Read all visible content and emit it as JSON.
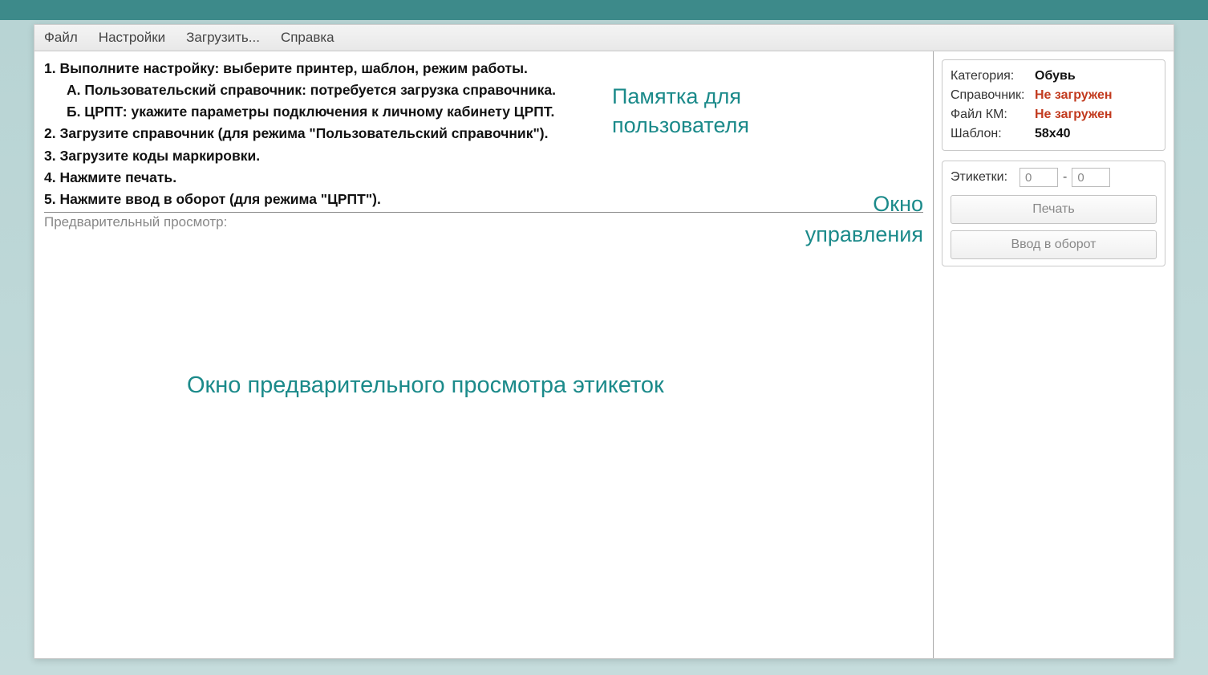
{
  "menubar": {
    "file": "Файл",
    "settings": "Настройки",
    "load": "Загрузить...",
    "help": "Справка"
  },
  "instructions": {
    "line1": "1. Выполните настройку: выберите принтер, шаблон, режим работы.",
    "line1a": "А. Пользовательский справочник: потребуется загрузка справочника.",
    "line1b": "Б. ЦРПТ: укажите параметры подключения к личному кабинету ЦРПТ.",
    "line2": "2. Загрузите справочник (для режима \"Пользовательский справочник\").",
    "line3": "3. Загрузите коды маркировки.",
    "line4": "4. Нажмите печать.",
    "line5": "5. Нажмите ввод в оборот (для режима \"ЦРПТ\")."
  },
  "preview_label": "Предварительный просмотр:",
  "annotations": {
    "memo_l1": "Памятка для",
    "memo_l2": "пользователя",
    "control_l1": "Окно",
    "control_l2": "управления",
    "preview": "Окно предварительного просмотра этикеток"
  },
  "info": {
    "category_k": "Категория:",
    "category_v": "Обувь",
    "ref_k": "Справочник:",
    "ref_v": "Не загружен",
    "km_k": "Файл КМ:",
    "km_v": "Не загружен",
    "tpl_k": "Шаблон:",
    "tpl_v": "58x40"
  },
  "labels": {
    "title": "Этикетки:",
    "from": "0",
    "to": "0"
  },
  "buttons": {
    "print": "Печать",
    "circulate": "Ввод в оборот"
  }
}
